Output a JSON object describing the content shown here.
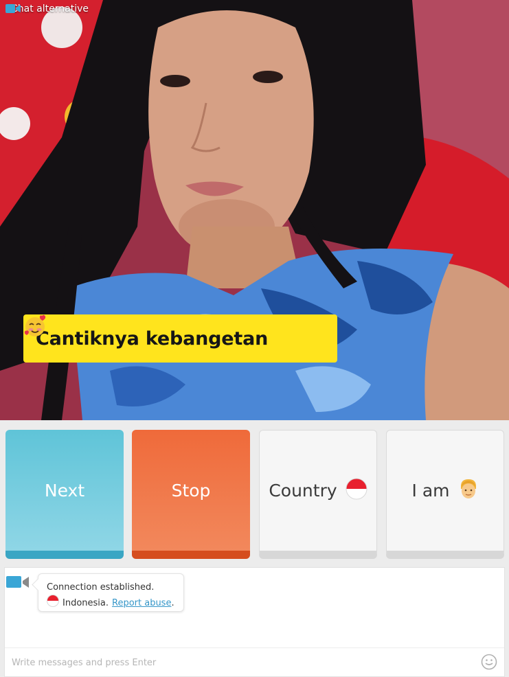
{
  "header": {
    "brand_label": "Chat alternative",
    "icon": "video-camera-icon"
  },
  "video": {
    "caption": "Cantiknya kebangetan",
    "caption_emoji": "smiling-face-with-hearts-icon"
  },
  "controls": {
    "next_label": "Next",
    "stop_label": "Stop",
    "country_label": "Country",
    "country_flag": "indonesia-flag-icon",
    "iam_label": "I am",
    "iam_icon": "man-emoji-icon"
  },
  "chat": {
    "status": "Connection established.",
    "country_name": "Indonesia.",
    "report_link": "Report abuse",
    "report_suffix": ".",
    "input_placeholder": "Write messages and press Enter",
    "emoji_button": "smiley-icon"
  },
  "colors": {
    "next": "#5fc4d8",
    "stop": "#ef6a3a",
    "caption_bg": "#ffe41d",
    "link": "#3596c8"
  }
}
